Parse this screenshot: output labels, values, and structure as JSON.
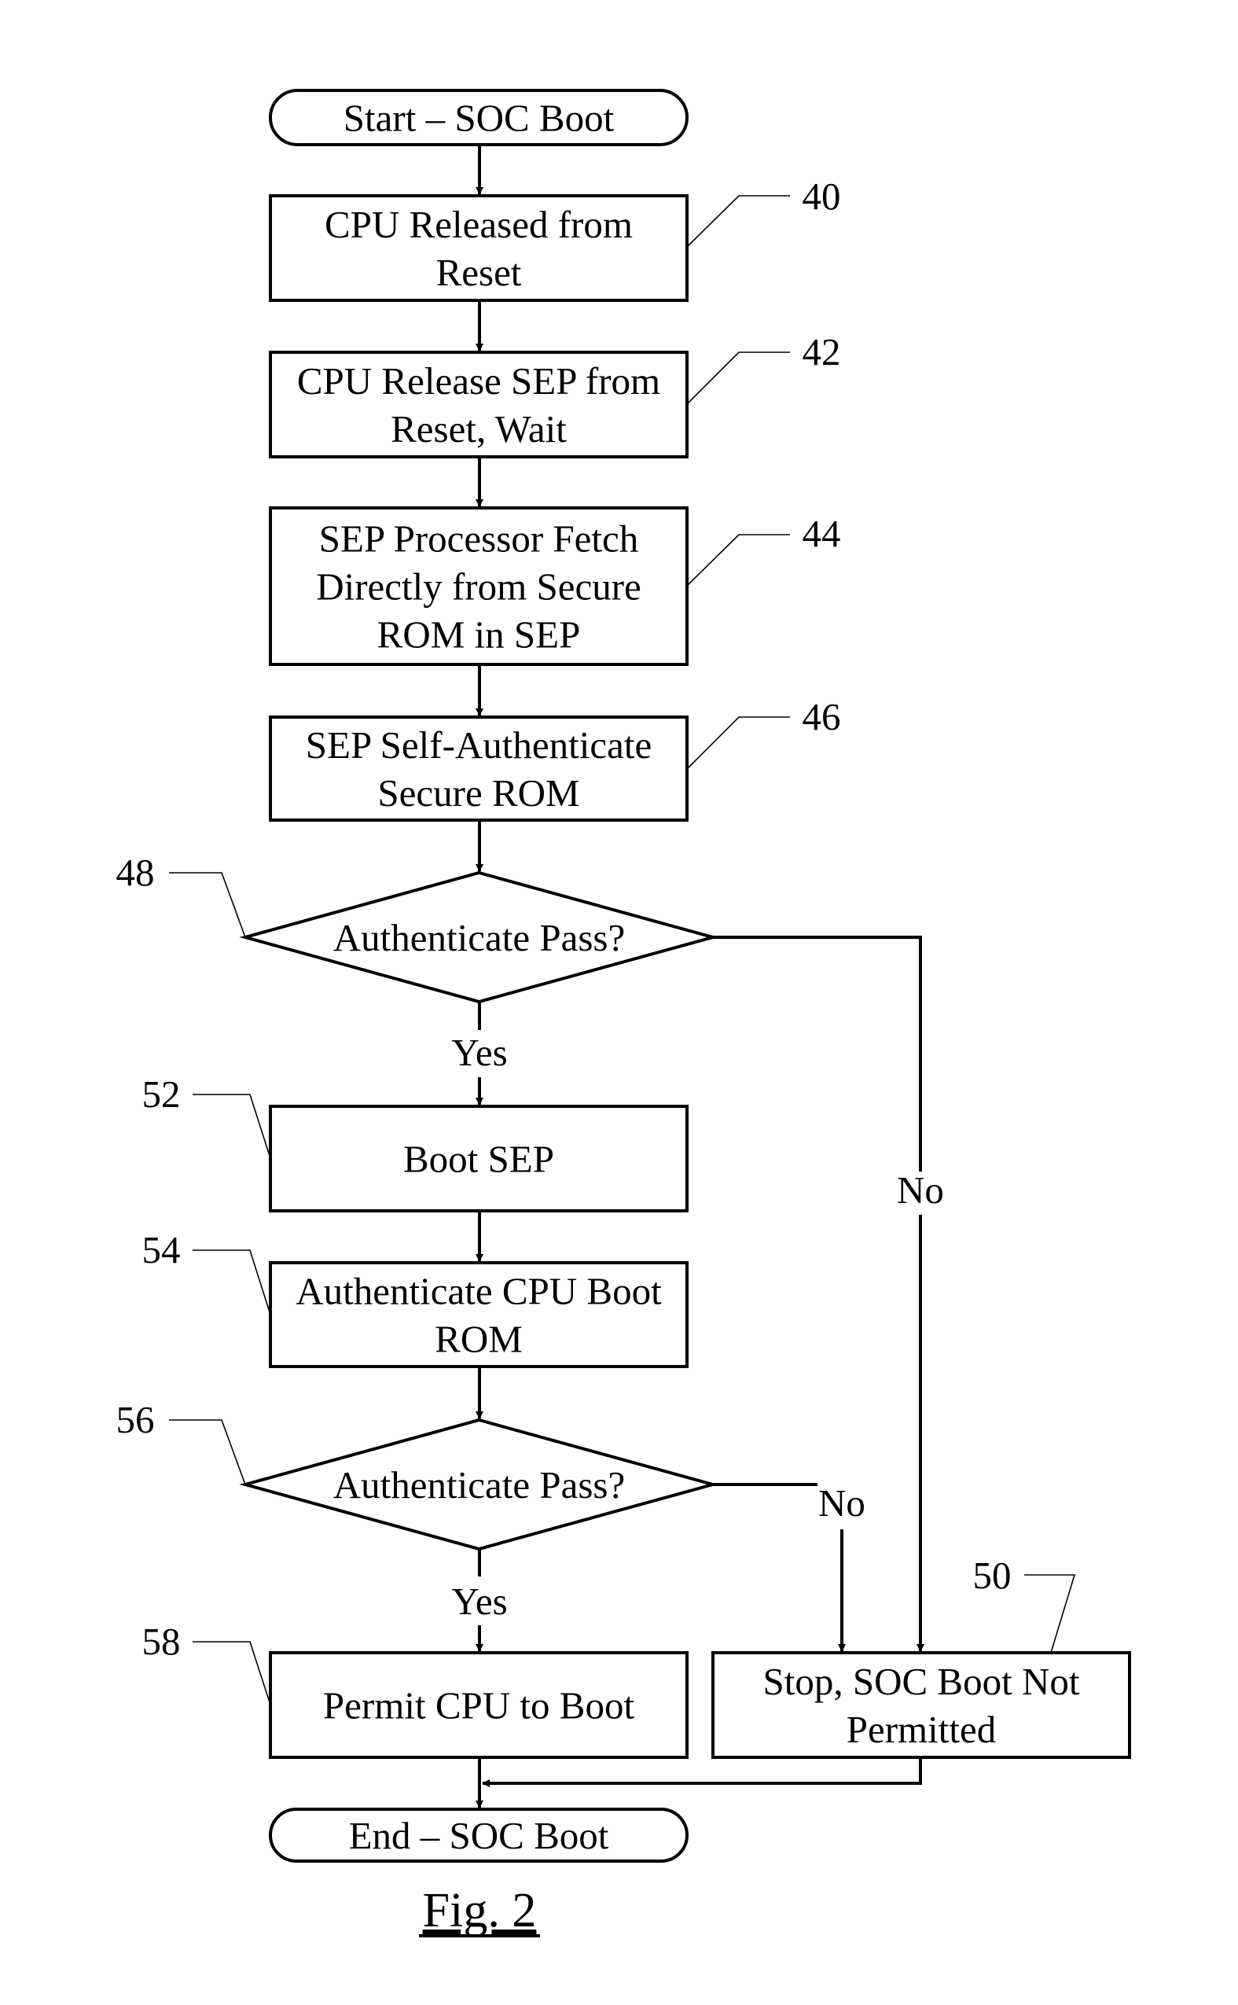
{
  "figure_label": "Fig. 2",
  "nodes": {
    "start": {
      "type": "terminal",
      "lines": [
        "Start – SOC Boot"
      ]
    },
    "n40": {
      "type": "process",
      "ref": "40",
      "lines": [
        "CPU Released from",
        "Reset"
      ]
    },
    "n42": {
      "type": "process",
      "ref": "42",
      "lines": [
        "CPU Release SEP from",
        "Reset, Wait"
      ]
    },
    "n44": {
      "type": "process",
      "ref": "44",
      "lines": [
        "SEP Processor Fetch",
        "Directly from Secure",
        "ROM in SEP"
      ]
    },
    "n46": {
      "type": "process",
      "ref": "46",
      "lines": [
        "SEP Self-Authenticate",
        "Secure ROM"
      ]
    },
    "n48": {
      "type": "decision",
      "ref": "48",
      "lines": [
        "Authenticate Pass?"
      ]
    },
    "n52": {
      "type": "process",
      "ref": "52",
      "lines": [
        "Boot SEP"
      ]
    },
    "n54": {
      "type": "process",
      "ref": "54",
      "lines": [
        "Authenticate CPU Boot",
        "ROM"
      ]
    },
    "n56": {
      "type": "decision",
      "ref": "56",
      "lines": [
        "Authenticate Pass?"
      ]
    },
    "n58": {
      "type": "process",
      "ref": "58",
      "lines": [
        "Permit CPU to Boot"
      ]
    },
    "n50": {
      "type": "process",
      "ref": "50",
      "lines": [
        "Stop, SOC Boot Not",
        "Permitted"
      ]
    },
    "end": {
      "type": "terminal",
      "lines": [
        "End – SOC Boot"
      ]
    }
  },
  "edges": [
    {
      "from": "start",
      "to": "n40",
      "label": ""
    },
    {
      "from": "n40",
      "to": "n42",
      "label": ""
    },
    {
      "from": "n42",
      "to": "n44",
      "label": ""
    },
    {
      "from": "n44",
      "to": "n46",
      "label": ""
    },
    {
      "from": "n46",
      "to": "n48",
      "label": ""
    },
    {
      "from": "n48",
      "to": "n52",
      "label": "Yes"
    },
    {
      "from": "n48",
      "to": "n50",
      "label": "No"
    },
    {
      "from": "n52",
      "to": "n54",
      "label": ""
    },
    {
      "from": "n54",
      "to": "n56",
      "label": ""
    },
    {
      "from": "n56",
      "to": "n58",
      "label": "Yes"
    },
    {
      "from": "n56",
      "to": "n50",
      "label": "No"
    },
    {
      "from": "n58",
      "to": "end",
      "label": ""
    },
    {
      "from": "n50",
      "to": "end",
      "label": ""
    }
  ],
  "edge_labels": {
    "yes1": "Yes",
    "no1": "No",
    "yes2": "Yes",
    "no2": "No"
  }
}
